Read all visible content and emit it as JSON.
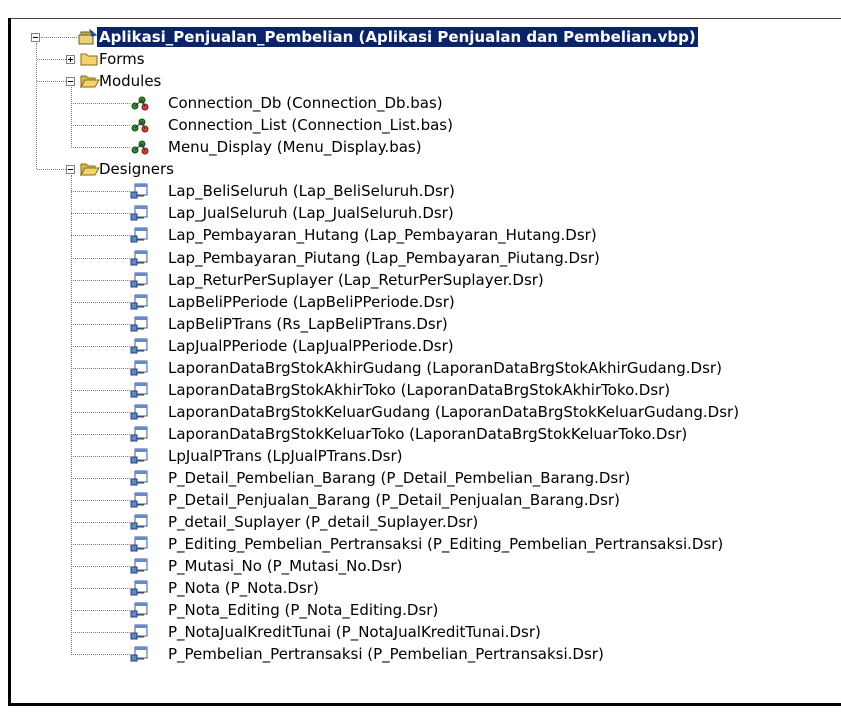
{
  "project": {
    "label": "Aplikasi_Penjualan_Pembelian (Aplikasi Penjualan dan Pembelian.vbp)",
    "icon": "vb-project-icon"
  },
  "folders": {
    "forms": {
      "label": "Forms",
      "expanded": false
    },
    "modules": {
      "label": "Modules",
      "expanded": true,
      "items": [
        "Connection_Db (Connection_Db.bas)",
        "Connection_List (Connection_List.bas)",
        "Menu_Display (Menu_Display.bas)"
      ]
    },
    "designers": {
      "label": "Designers",
      "expanded": true,
      "items": [
        "Lap_BeliSeluruh (Lap_BeliSeluruh.Dsr)",
        "Lap_JualSeluruh (Lap_JualSeluruh.Dsr)",
        "Lap_Pembayaran_Hutang (Lap_Pembayaran_Hutang.Dsr)",
        "Lap_Pembayaran_Piutang (Lap_Pembayaran_Piutang.Dsr)",
        "Lap_ReturPerSuplayer (Lap_ReturPerSuplayer.Dsr)",
        "LapBeliPPeriode (LapBeliPPeriode.Dsr)",
        "LapBeliPTrans (Rs_LapBeliPTrans.Dsr)",
        "LapJualPPeriode (LapJualPPeriode.Dsr)",
        "LaporanDataBrgStokAkhirGudang (LaporanDataBrgStokAkhirGudang.Dsr)",
        "LaporanDataBrgStokAkhirToko (LaporanDataBrgStokAkhirToko.Dsr)",
        "LaporanDataBrgStokKeluarGudang (LaporanDataBrgStokKeluarGudang.Dsr)",
        "LaporanDataBrgStokKeluarToko (LaporanDataBrgStokKeluarToko.Dsr)",
        "LpJualPTrans (LpJualPTrans.Dsr)",
        "P_Detail_Pembelian_Barang (P_Detail_Pembelian_Barang.Dsr)",
        "P_Detail_Penjualan_Barang (P_Detail_Penjualan_Barang.Dsr)",
        "P_detail_Suplayer (P_detail_Suplayer.Dsr)",
        "P_Editing_Pembelian_Pertransaksi (P_Editing_Pembelian_Pertransaksi.Dsr)",
        "P_Mutasi_No (P_Mutasi_No.Dsr)",
        "P_Nota (P_Nota.Dsr)",
        "P_Nota_Editing (P_Nota_Editing.Dsr)",
        "P_NotaJualKreditTunai (P_NotaJualKreditTunai.Dsr)",
        "P_Pembelian_Pertransaksi (P_Pembelian_Pertransaksi.Dsr)"
      ]
    }
  },
  "colors": {
    "selection": "#0a246a",
    "folder": "#f4d36b",
    "module": "#2c8f2c"
  }
}
